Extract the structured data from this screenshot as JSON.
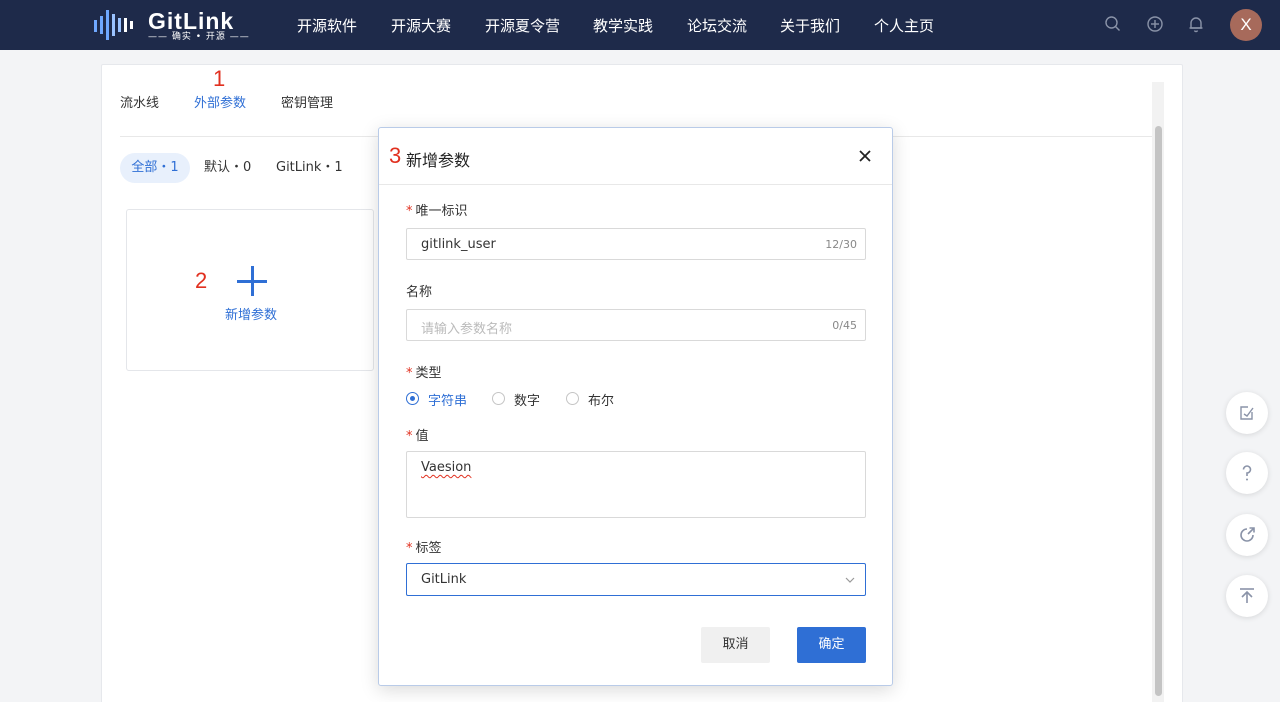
{
  "header": {
    "logo_text": "GitLink",
    "logo_subtitle": "—— 确实 • 开源 ——",
    "nav": [
      "开源软件",
      "开源大赛",
      "开源夏令营",
      "教学实践",
      "论坛交流",
      "关于我们",
      "个人主页"
    ],
    "avatar_letter": "X"
  },
  "annotations": {
    "n1": "1",
    "n2": "2",
    "n3": "3"
  },
  "tabs": [
    "流水线",
    "外部参数",
    "密钥管理"
  ],
  "filters": [
    "全部・1",
    "默认・0",
    "GitLink・1"
  ],
  "add_card_label": "新增参数",
  "modal": {
    "title": "新增参数",
    "required_mark": "*",
    "id_label": "唯一标识",
    "id_value": "gitlink_user",
    "id_count": "12/30",
    "name_label": "名称",
    "name_placeholder": "请输入参数名称",
    "name_count": "0/45",
    "type_label": "类型",
    "type_options": [
      "字符串",
      "数字",
      "布尔"
    ],
    "value_label": "值",
    "value_text": "Vaesion",
    "tag_label": "标签",
    "tag_value": "GitLink",
    "cancel": "取消",
    "ok": "确定"
  },
  "colors": {
    "accent": "#2f6fd5",
    "topbar": "#1e2a4a",
    "annotation_red": "#e1301f"
  }
}
